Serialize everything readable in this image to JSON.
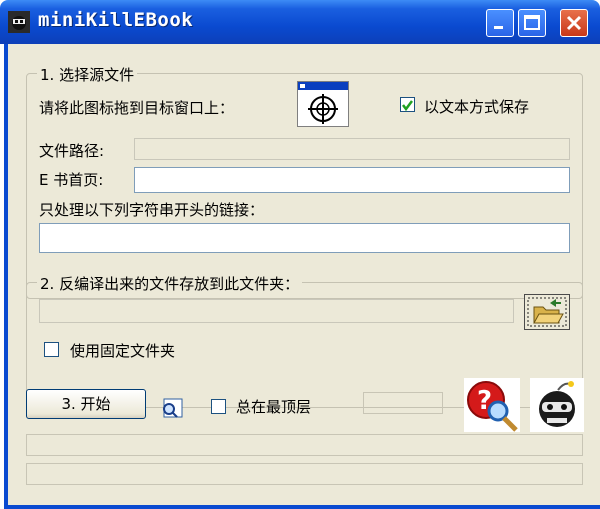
{
  "window": {
    "title": "miniKillEBook"
  },
  "group_source": {
    "title": "1. 选择源文件",
    "drag_label": "请将此图标拖到目标窗口上：",
    "save_as_text_label": "以文本方式保存",
    "save_as_text_checked": true,
    "file_path_label": "文件路径:",
    "file_path_value": "",
    "ebook_home_label": "E 书首页:",
    "ebook_home_value": "",
    "prefix_label": "只处理以下列字符串开头的链接：",
    "prefix_value": ""
  },
  "group_output": {
    "title": "2. 反编译出来的文件存放到此文件夹：",
    "folder_value": "",
    "fixed_folder_label": "使用固定文件夹",
    "fixed_folder_checked": false
  },
  "bottom": {
    "start_label": "3. 开始",
    "always_on_top_label": "总在最顶层",
    "always_on_top_checked": false
  },
  "icons": [
    "app-bomb-icon",
    "crosshair-target-icon",
    "open-folder-icon",
    "find-window-icon",
    "help-search-icon",
    "bomb-icon",
    "minimize-icon",
    "maximize-icon",
    "close-icon"
  ]
}
